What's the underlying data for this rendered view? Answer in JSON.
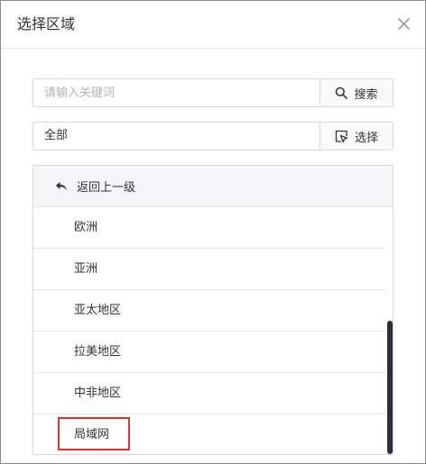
{
  "dialog": {
    "title": "选择区域",
    "close_icon": "close-icon"
  },
  "search": {
    "placeholder": "请输入关键词",
    "value": "",
    "button_label": "搜索",
    "button_icon": "search-icon"
  },
  "selection": {
    "value": "全部",
    "button_label": "选择",
    "button_icon": "select-cursor-icon"
  },
  "list": {
    "back_label": "返回上一级",
    "back_icon": "back-arrow-icon",
    "items": [
      {
        "label": "欧洲"
      },
      {
        "label": "亚洲"
      },
      {
        "label": "亚太地区"
      },
      {
        "label": "拉美地区"
      },
      {
        "label": "中非地区"
      },
      {
        "label": "局域网",
        "highlighted": true
      }
    ],
    "highlight_color": "#e03131",
    "scrollbar_color": "#2d2f3a"
  }
}
